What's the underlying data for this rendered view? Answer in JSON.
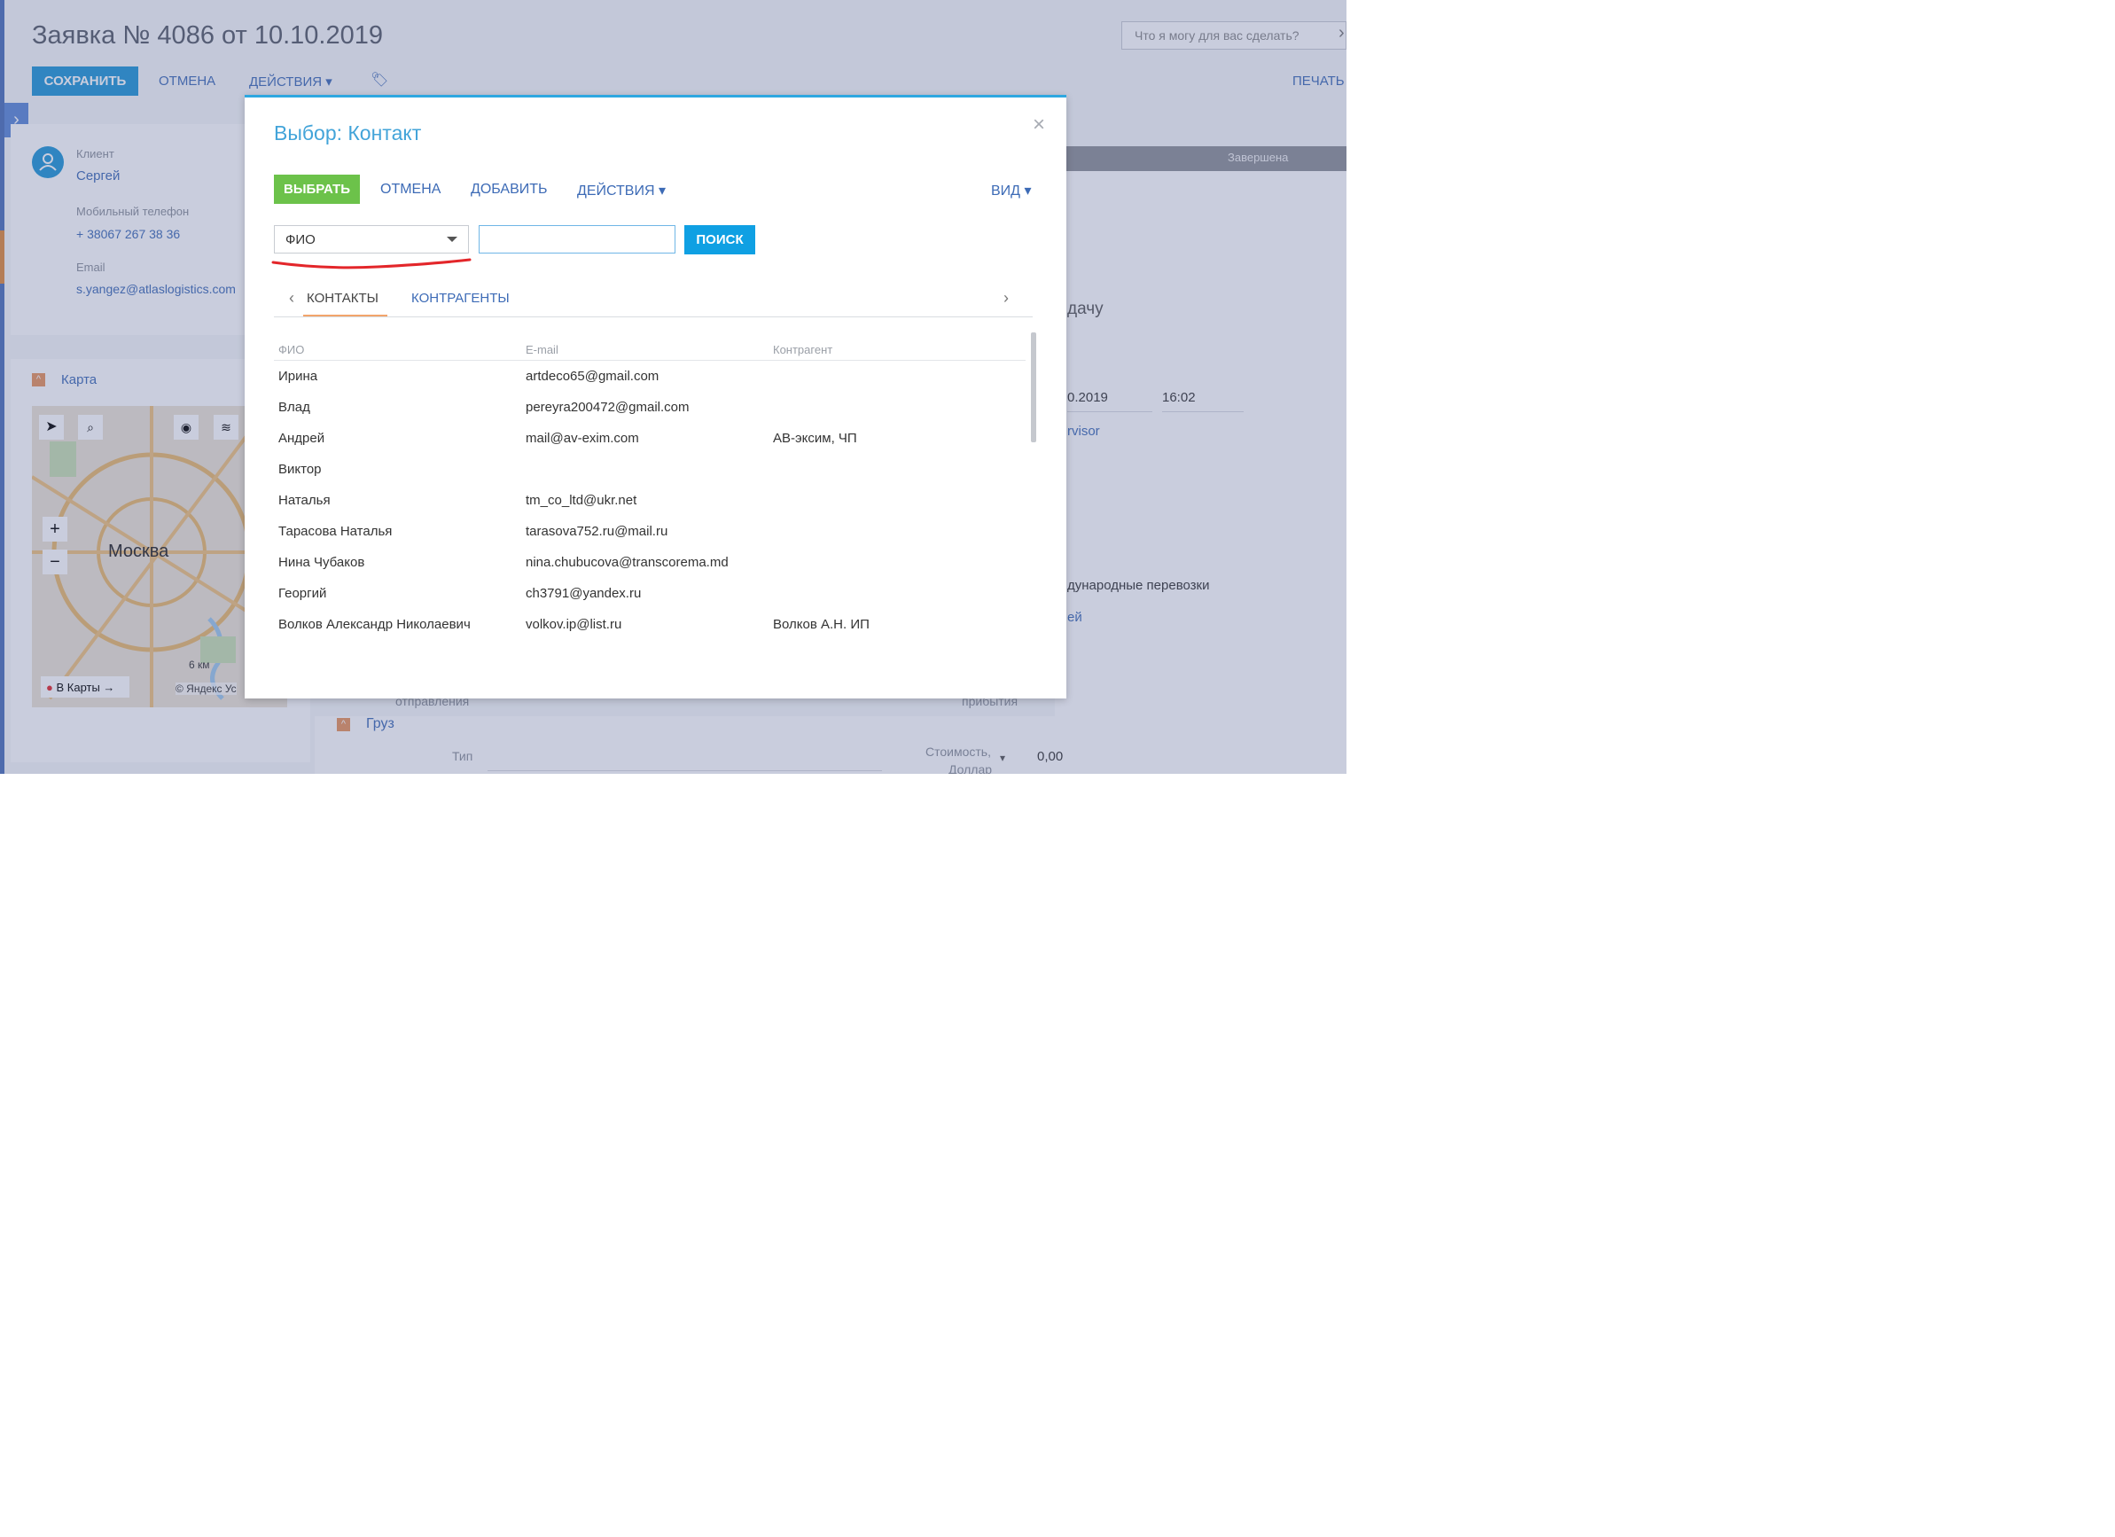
{
  "page": {
    "title": "Заявка № 4086 от 10.10.2019",
    "toolbar": {
      "save": "СОХРАНИТЬ",
      "cancel": "ОТМЕНА",
      "actions": "ДЕЙСТВИЯ",
      "print": "ПЕЧАТЬ"
    },
    "help_placeholder": "Что я могу для вас сделать?",
    "client": {
      "label": "Клиент",
      "name": "Сергей",
      "phone_label": "Мобильный телефон",
      "phone": "+ 38067 267 38 36",
      "email_label": "Email",
      "email": "s.yangez@atlaslogistics.com"
    },
    "map": {
      "section_label": "Карта",
      "city": "Москва",
      "scale": "6 км",
      "open_button": "В Карты →",
      "copyright": "© Яндекс Ус"
    },
    "stage_label": "Завершена",
    "partial_text": {
      "handover": "дачу",
      "date": "0.2019",
      "time": "16:02",
      "supervisor": "rvisor",
      "transport": "дународные перевозки",
      "link": "ей",
      "departure": "отправления",
      "arrival": "прибытия"
    },
    "cargo": {
      "section_label": "Груз",
      "type_label": "Тип",
      "cost_label": "Стоимость,",
      "currency_label": "Доллар",
      "cost_value": "0,00"
    }
  },
  "modal": {
    "title": "Выбор: Контакт",
    "toolbar": {
      "select": "ВЫБРАТЬ",
      "cancel": "ОТМЕНА",
      "add": "ДОБАВИТЬ",
      "actions": "ДЕЙСТВИЯ",
      "view": "ВИД"
    },
    "filter": {
      "field": "ФИО",
      "search_value": "",
      "search_button": "ПОИСК"
    },
    "tabs": [
      {
        "label": "КОНТАКТЫ",
        "active": true
      },
      {
        "label": "КОНТРАГЕНТЫ",
        "active": false
      }
    ],
    "columns": [
      "ФИО",
      "E-mail",
      "Контрагент"
    ],
    "rows": [
      [
        "Ирина",
        "artdeco65@gmail.com",
        ""
      ],
      [
        "Влад",
        "pereyra200472@gmail.com",
        ""
      ],
      [
        "Андрей",
        "mail@av-exim.com",
        "АВ-эксим, ЧП"
      ],
      [
        "Виктор",
        "",
        ""
      ],
      [
        "Наталья",
        "tm_co_ltd@ukr.net",
        ""
      ],
      [
        "Тарасова Наталья",
        "tarasova752.ru@mail.ru",
        ""
      ],
      [
        "Нина Чубаков",
        "nina.chubucova@transcorema.md",
        ""
      ],
      [
        "Георгий",
        "ch3791@yandex.ru",
        ""
      ],
      [
        "Волков Александр Николаевич",
        "volkov.ip@list.ru",
        "Волков А.Н. ИП"
      ]
    ]
  },
  "colors": {
    "accent_blue": "#1e95d6",
    "select_green": "#6cc24a",
    "search_blue": "#0fa0e3",
    "tab_underline": "#f2a46b",
    "annotation_red": "#e3262a"
  }
}
